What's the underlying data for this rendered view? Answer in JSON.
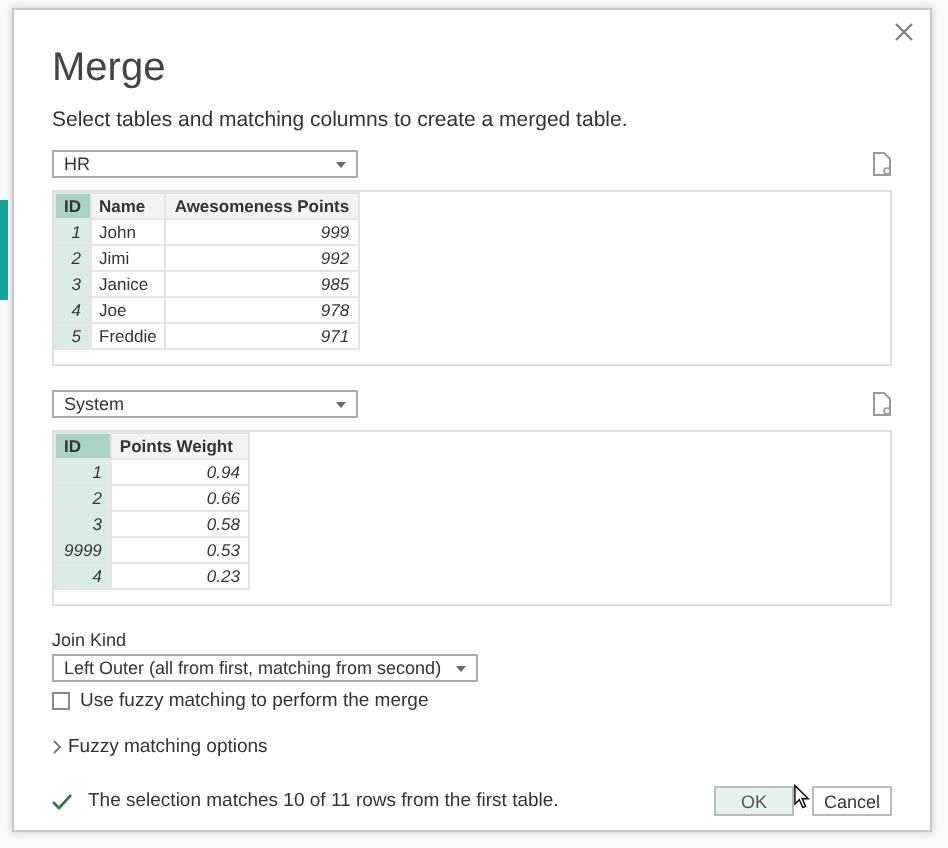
{
  "dialog": {
    "title": "Merge",
    "subtitle": "Select tables and matching columns to create a merged table.",
    "tables": [
      {
        "source": "HR",
        "columns": [
          {
            "label": "ID",
            "selected": true
          },
          {
            "label": "Name",
            "selected": false
          },
          {
            "label": "Awesomeness Points",
            "selected": false
          }
        ],
        "rows": [
          [
            "1",
            "John",
            "999"
          ],
          [
            "2",
            "Jimi",
            "992"
          ],
          [
            "3",
            "Janice",
            "985"
          ],
          [
            "4",
            "Joe",
            "978"
          ],
          [
            "5",
            "Freddie",
            "971"
          ]
        ]
      },
      {
        "source": "System",
        "columns": [
          {
            "label": "ID",
            "selected": true
          },
          {
            "label": "Points Weight",
            "selected": false
          }
        ],
        "rows": [
          [
            "1",
            "0.94"
          ],
          [
            "2",
            "0.66"
          ],
          [
            "3",
            "0.58"
          ],
          [
            "9999",
            "0.53"
          ],
          [
            "4",
            "0.23"
          ]
        ]
      }
    ],
    "join_kind": {
      "label": "Join Kind",
      "value": "Left Outer (all from first, matching from second)"
    },
    "fuzzy": {
      "label": "Use fuzzy matching to perform the merge",
      "checked": false
    },
    "fuzzy_options": {
      "label": "Fuzzy matching options",
      "expanded": false
    },
    "status": "The selection matches 10 of 11 rows from the first table.",
    "buttons": [
      "OK",
      "Cancel"
    ]
  }
}
